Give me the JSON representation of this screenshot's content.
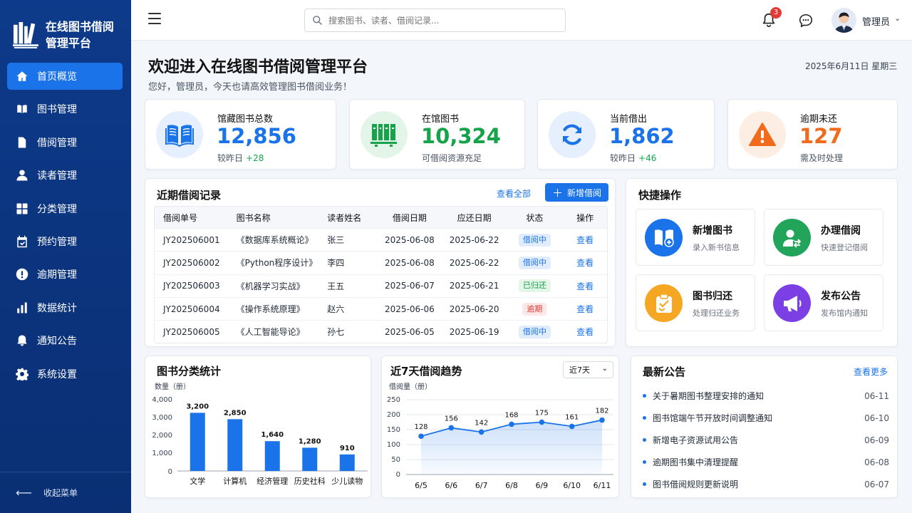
{
  "app": {
    "title": "在线图书借阅管理平台"
  },
  "sidebar": {
    "items": [
      {
        "label": "首页概览",
        "icon": "home-icon",
        "active": true
      },
      {
        "label": "图书管理",
        "icon": "book-icon"
      },
      {
        "label": "借阅管理",
        "icon": "document-icon"
      },
      {
        "label": "读者管理",
        "icon": "user-icon"
      },
      {
        "label": "分类管理",
        "icon": "grid-icon"
      },
      {
        "label": "预约管理",
        "icon": "calendar-icon"
      },
      {
        "label": "逾期管理",
        "icon": "alert-icon"
      },
      {
        "label": "数据统计",
        "icon": "bar-chart-icon"
      },
      {
        "label": "通知公告",
        "icon": "bell-icon"
      },
      {
        "label": "系统设置",
        "icon": "gear-icon"
      }
    ],
    "collapse_label": "收起菜单"
  },
  "header": {
    "search_placeholder": "搜索图书、读者、借阅记录...",
    "notification_count": "3",
    "user_name": "管理员"
  },
  "welcome": {
    "title": "欢迎进入在线图书借阅管理平台",
    "subtitle": "您好，管理员，今天也请高效管理图书借阅业务！",
    "date": "2025年6月11日 星期三"
  },
  "stats": [
    {
      "label": "馆藏图书总数",
      "value": "12,856",
      "note": "较昨日",
      "delta": "+28",
      "color": "#1a73e8"
    },
    {
      "label": "在馆图书",
      "value": "10,324",
      "note": "可借阅资源充足",
      "delta": "",
      "color": "#16a34a"
    },
    {
      "label": "当前借出",
      "value": "1,862",
      "note": "较昨日",
      "delta": "+46",
      "color": "#1a73e8"
    },
    {
      "label": "逾期未还",
      "value": "127",
      "note": "需及时处理",
      "delta": "",
      "color": "#f26b1d"
    }
  ],
  "borrow": {
    "title": "近期借阅记录",
    "view_all": "查看全部",
    "add_label": "新增借阅",
    "columns": [
      "借阅单号",
      "图书名称",
      "读者姓名",
      "借阅日期",
      "应还日期",
      "状态",
      "操作"
    ],
    "rows": [
      {
        "id": "JY202506001",
        "book": "《数据库系统概论》",
        "reader": "张三",
        "borrow": "2025-06-08",
        "due": "2025-06-22",
        "status": "借阅中",
        "status_type": "blue",
        "action": "查看"
      },
      {
        "id": "JY202506002",
        "book": "《Python程序设计》",
        "reader": "李四",
        "borrow": "2025-06-08",
        "due": "2025-06-22",
        "status": "借阅中",
        "status_type": "blue",
        "action": "查看"
      },
      {
        "id": "JY202506003",
        "book": "《机器学习实战》",
        "reader": "王五",
        "borrow": "2025-06-07",
        "due": "2025-06-21",
        "status": "已归还",
        "status_type": "green",
        "action": "查看"
      },
      {
        "id": "JY202506004",
        "book": "《操作系统原理》",
        "reader": "赵六",
        "borrow": "2025-06-06",
        "due": "2025-06-20",
        "status": "逾期",
        "status_type": "red",
        "action": "查看"
      },
      {
        "id": "JY202506005",
        "book": "《人工智能导论》",
        "reader": "孙七",
        "borrow": "2025-06-05",
        "due": "2025-06-19",
        "status": "借阅中",
        "status_type": "blue",
        "action": "查看"
      }
    ]
  },
  "quick": {
    "title": "快捷操作",
    "items": [
      {
        "title": "新增图书",
        "sub": "录入新书信息",
        "color": "#1a73e8",
        "icon": "add-book-icon"
      },
      {
        "title": "办理借阅",
        "sub": "快速登记借阅",
        "color": "#22a55a",
        "icon": "user-transfer-icon"
      },
      {
        "title": "图书归还",
        "sub": "处理归还业务",
        "color": "#f5a623",
        "icon": "return-box-icon"
      },
      {
        "title": "发布公告",
        "sub": "发布馆内通知",
        "color": "#7b3fe4",
        "icon": "megaphone-icon"
      }
    ]
  },
  "category_chart": {
    "title": "图书分类统计",
    "ylabel": "数量（册）",
    "y_ticks": [
      "4,000",
      "3,000",
      "2,000",
      "1,000",
      "0"
    ],
    "value_labels": [
      "3,200",
      "2,850",
      "1,640",
      "1,280",
      "910"
    ]
  },
  "trend_chart": {
    "title": "近7天借阅趋势",
    "ylabel": "借阅量（册）",
    "range_selected": "近7天",
    "y_ticks": [
      "250",
      "200",
      "150",
      "100",
      "50",
      "0"
    ]
  },
  "notices": {
    "title": "最新公告",
    "more": "查看更多",
    "items": [
      {
        "text": "关于暑期图书整理安排的通知",
        "date": "06-11"
      },
      {
        "text": "图书馆端午节开放时间调整通知",
        "date": "06-10"
      },
      {
        "text": "新增电子资源试用公告",
        "date": "06-09"
      },
      {
        "text": "逾期图书集中清理提醒",
        "date": "06-08"
      },
      {
        "text": "图书借阅规则更新说明",
        "date": "06-07"
      }
    ]
  },
  "chart_data": [
    {
      "type": "bar",
      "title": "图书分类统计",
      "ylabel": "数量（册）",
      "categories": [
        "文学",
        "计算机",
        "经济管理",
        "历史社科",
        "少儿读物"
      ],
      "values": [
        3200,
        2850,
        1640,
        1280,
        910
      ],
      "ylim": [
        0,
        4000
      ],
      "color": "#1a73e8"
    },
    {
      "type": "area",
      "title": "近7天借阅趋势",
      "ylabel": "借阅量（册）",
      "categories": [
        "6/5",
        "6/6",
        "6/7",
        "6/8",
        "6/9",
        "6/10",
        "6/11"
      ],
      "values": [
        128,
        156,
        142,
        168,
        175,
        161,
        182
      ],
      "ylim": [
        0,
        250
      ],
      "color": "#1a73e8"
    }
  ]
}
